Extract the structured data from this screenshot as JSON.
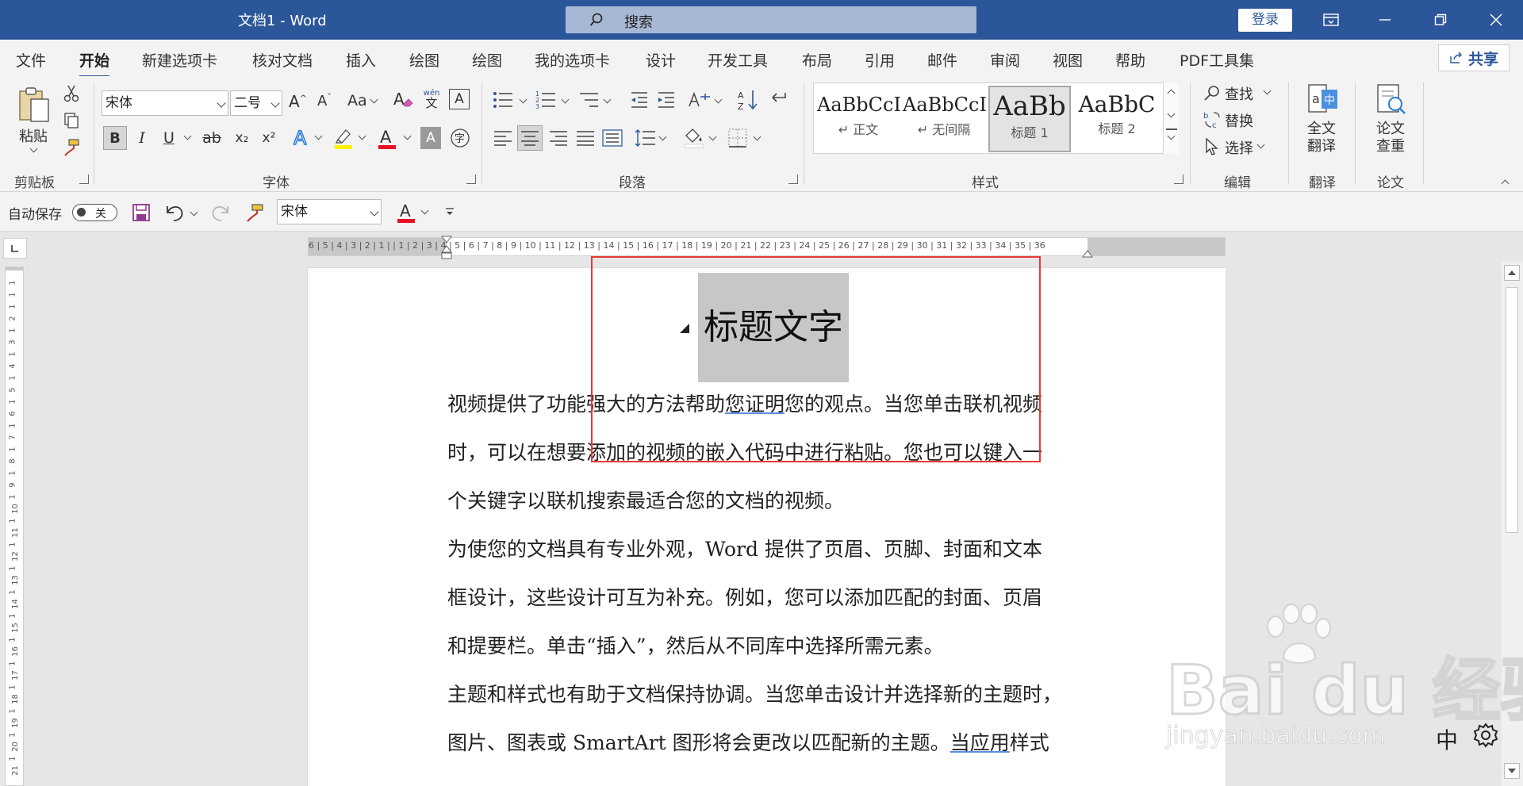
{
  "titlebar": {
    "doc_title": "文档1  -  Word",
    "search_label": "搜索",
    "login_label": "登录"
  },
  "tabs": [
    "文件",
    "开始",
    "新建选项卡",
    "核对文档",
    "插入",
    "绘图",
    "绘图",
    "我的选项卡",
    "设计",
    "开发工具",
    "布局",
    "引用",
    "邮件",
    "审阅",
    "视图",
    "帮助",
    "PDF工具集"
  ],
  "active_tab": "开始",
  "share_label": "共享",
  "ribbon": {
    "paste_label": "粘贴",
    "font_name": "宋体",
    "font_size": "二号",
    "group_labels": {
      "clipboard": "剪贴板",
      "font": "字体",
      "paragraph": "段落",
      "styles": "样式",
      "editing": "编辑",
      "translate": "翻译",
      "paper": "论文"
    },
    "styles": [
      {
        "preview": "AaBbCcI",
        "name": "↵ 正文"
      },
      {
        "preview": "AaBbCcI",
        "name": "↵ 无间隔"
      },
      {
        "preview": "AaBb",
        "name": "标题 1"
      },
      {
        "preview": "AaBbC",
        "name": "标题 2"
      }
    ],
    "editing": {
      "find": "查找",
      "replace": "替换",
      "select": "选择"
    },
    "translate_button": [
      "全文",
      "翻译"
    ],
    "paper_button": [
      "论文",
      "查重"
    ],
    "font_glyphs": {
      "bold": "B",
      "italic": "I",
      "underline": "U",
      "strike": "ab",
      "subscript": "x₂",
      "superscript": "x²",
      "grow": "A^",
      "shrink": "Aˇ",
      "case": "Aa",
      "phonetic_top": "wén",
      "phonetic_bottom": "文"
    }
  },
  "qat": {
    "autosave_label": "自动保存",
    "autosave_state": "关",
    "font_name": "宋体"
  },
  "ruler": {
    "numbers": "6 | 5 | 4 | 3 | 2 | 1 |   | 1 | 2 | 3 | 4 | 5 | 6 | 7 | 8 | 9 | 10 | 11 | 12 | 13 | 14 | 15 | 16 | 17 | 18 | 19 | 20 | 21 | 22 | 23 | 24 | 25 | 26 | 27 | 28 | 29 | 30 | 31 | 32 | 33 | 34 | 35 | 36",
    "vertical_numbers": [
      "1",
      "1",
      "1",
      "2",
      "1",
      "3",
      "1",
      "4",
      "1",
      "5",
      "1",
      "6",
      "1",
      "7",
      "1",
      "8",
      "1",
      "9",
      "1",
      "10",
      "1",
      "11",
      "1",
      "12",
      "1",
      "13",
      "1",
      "14",
      "1",
      "15",
      "1",
      "16",
      "1",
      "17",
      "1",
      "18",
      "1",
      "19",
      "1",
      "20",
      "1",
      "21"
    ]
  },
  "document": {
    "title": "标题文字",
    "lines": [
      {
        "parts": [
          {
            "t": "视频提供了功能强大的方法帮助"
          },
          {
            "t": "您证明",
            "u": true
          },
          {
            "t": "您的观点。当您单击联机视频"
          }
        ]
      },
      {
        "parts": [
          {
            "t": "时，可以在想要添加的视频的嵌入代码中进行粘贴。您也可以键入一"
          }
        ]
      },
      {
        "parts": [
          {
            "t": "个关键字以联机搜索最适合您的文档的视频。"
          }
        ]
      },
      {
        "parts": [
          {
            "t": "为使您的文档具有专业外观，Word  提供了页眉、页脚、封面和文本"
          }
        ]
      },
      {
        "parts": [
          {
            "t": "框设计，这些设计可互为补充。例如，您可以添加匹配的封面、页眉"
          }
        ]
      },
      {
        "parts": [
          {
            "t": "和提要栏。单击“插入”，然后从不同库中选择所需元素。"
          }
        ]
      },
      {
        "parts": [
          {
            "t": "主题和样式也有助于文档保持协调。当您单击设计并选择新的主题时，"
          }
        ]
      },
      {
        "parts": [
          {
            "t": "图片、图表或 SmartArt 图形将会更改以匹配新的主题。"
          },
          {
            "t": "当应用",
            "u": true
          },
          {
            "t": "样式"
          }
        ]
      }
    ]
  },
  "status": {
    "ime": "中"
  },
  "watermark": {
    "main": "Bai du 经验",
    "sub": "jingyan.baidu.com"
  },
  "colors": {
    "title_bar": "#2b579a",
    "highlight_box": "#e53935",
    "font_color_underline": "#e81123",
    "highlight_color": "#fff200"
  }
}
